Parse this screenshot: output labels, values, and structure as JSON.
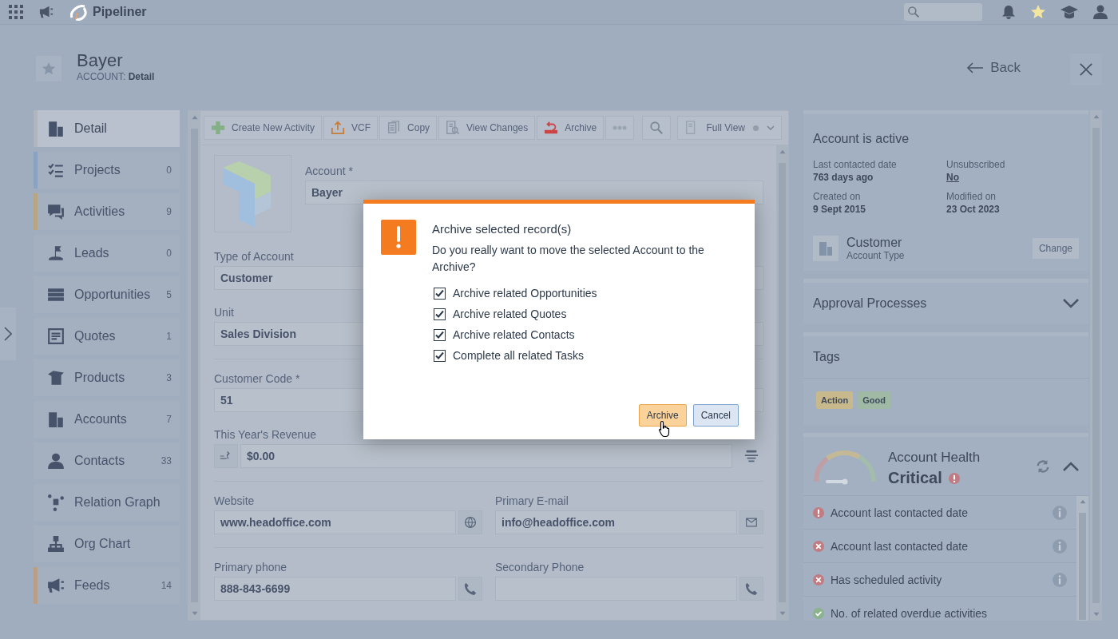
{
  "top_bar": {
    "logo_text": "Pipeliner"
  },
  "header": {
    "title": "Bayer",
    "breadcrumb": "ACCOUNT: **Detail**",
    "back_label": "Back"
  },
  "sidebar": {
    "items": [
      {
        "label": "Detail",
        "selected": true,
        "color": "#b0b6be"
      },
      {
        "label": "Projects",
        "count": "0",
        "selected": false,
        "color": "#8ba3c2"
      },
      {
        "label": "Activities",
        "count": "9",
        "selected": false,
        "color": "#b6a684"
      },
      {
        "label": "Leads",
        "count": "0",
        "selected": false
      },
      {
        "label": "Opportunities",
        "count": "5",
        "selected": false
      },
      {
        "label": "Quotes",
        "count": "1",
        "selected": false
      },
      {
        "label": "Products",
        "count": "3",
        "selected": false
      },
      {
        "label": "Accounts",
        "count": "7",
        "selected": false
      },
      {
        "label": "Contacts",
        "count": "33",
        "selected": false
      },
      {
        "label": "Relation Graph",
        "selected": false
      },
      {
        "label": "Org Chart",
        "selected": false
      },
      {
        "label": "Feeds",
        "count": "14",
        "selected": false,
        "color": "#b89f86"
      }
    ]
  },
  "toolbar": {
    "actions": [
      {
        "label": "Create New Activity",
        "kind": "create"
      },
      {
        "label": "VCF",
        "kind": "export"
      },
      {
        "label": "Copy",
        "kind": "copy"
      },
      {
        "label": "View Changes",
        "kind": "changes"
      },
      {
        "label": "Archive",
        "kind": "archive"
      },
      {
        "kind": "more"
      }
    ],
    "view_select": {
      "value": "Full View"
    }
  },
  "form": {
    "account": {
      "label": "Account *",
      "value": "Bayer"
    },
    "sections": [
      {
        "rows": [
          {
            "fields": [
              {
                "label": "Type of Account",
                "value": "Customer",
                "kind": "text"
              }
            ]
          },
          {
            "fields": [
              {
                "label": "Unit",
                "value": "Sales Division",
                "kind": "text"
              }
            ]
          }
        ]
      },
      {
        "rows": [
          {
            "fields": [
              {
                "label": "Customer Code *",
                "value": "51",
                "kind": "text"
              }
            ]
          },
          {
            "fields": [
              {
                "label": "This Year's Revenue",
                "value": "$0.00",
                "kind": "currency"
              }
            ]
          }
        ]
      },
      {
        "rows": [
          {
            "fields": [
              {
                "label": "Website",
                "value": "www.headoffice.com",
                "kind": "web"
              },
              {
                "label": "Primary E-mail",
                "value": "info@headoffice.com",
                "kind": "email"
              }
            ]
          }
        ]
      },
      {
        "rows": [
          {
            "fields": [
              {
                "label": "Primary phone",
                "value": "888-843-6699",
                "kind": "phone"
              },
              {
                "label": "Secondary Phone",
                "kind": "phone"
              }
            ]
          }
        ]
      }
    ]
  },
  "status_card": {
    "title": "Account is active",
    "facts": [
      {
        "label": "Last contacted date",
        "value": "763 days ago",
        "kind": "text"
      },
      {
        "label": "Unsubscribed",
        "value": "No",
        "kind": "link"
      },
      {
        "label": "Created on",
        "value": "9 Sept 2015",
        "kind": "text"
      },
      {
        "label": "Modified on",
        "value": "23 Oct 2023",
        "kind": "text"
      }
    ],
    "account_type": {
      "value": "Customer",
      "label": "Account Type",
      "button": "Change"
    }
  },
  "approval": {
    "title": "Approval Processes",
    "expanded": false
  },
  "tags": {
    "title": "Tags",
    "items": [
      {
        "label": "Action",
        "color": "#c8b98c"
      },
      {
        "label": "Good",
        "color": "#a0b9a4"
      }
    ]
  },
  "health": {
    "title": "Account Health",
    "status": "Critical",
    "expanded": true,
    "checks": [
      {
        "label": "Account last contacted date",
        "kind": "warning",
        "info": true
      },
      {
        "label": "Account last contacted date",
        "kind": "fail",
        "info": true
      },
      {
        "label": "Has scheduled activity",
        "kind": "fail",
        "info": true
      },
      {
        "label": "No. of related overdue activities",
        "kind": "pass",
        "info": false
      }
    ]
  },
  "dialog": {
    "title": "Archive selected record(s)",
    "message": "Do you really want to move the selected Account to the Archive?",
    "options": [
      {
        "label": "Archive related Opportunities",
        "checked": true
      },
      {
        "label": "Archive related Quotes",
        "checked": true
      },
      {
        "label": "Archive related Contacts",
        "checked": true
      },
      {
        "label": "Complete all related Tasks",
        "checked": true
      }
    ],
    "buttons": [
      {
        "label": "Archive",
        "kind": "primary",
        "hovered": true
      },
      {
        "label": "Cancel",
        "kind": "secondary",
        "hovered": false
      }
    ]
  }
}
